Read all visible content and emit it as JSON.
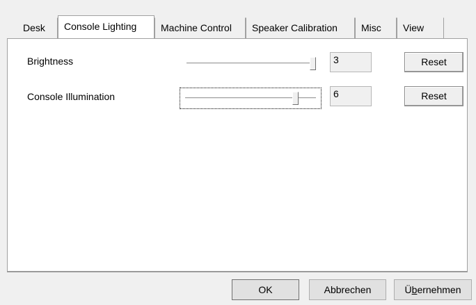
{
  "tabs": [
    {
      "label": "Desk"
    },
    {
      "label": "Console Lighting"
    },
    {
      "label": "Machine Control"
    },
    {
      "label": "Speaker Calibration"
    },
    {
      "label": "Misc"
    },
    {
      "label": "View"
    }
  ],
  "selected_tab": "Console Lighting",
  "settings": [
    {
      "label": "Brightness",
      "value": "3",
      "slider_level": 1.0,
      "reset_label": "Reset"
    },
    {
      "label": "Console Illumination",
      "value": "6",
      "slider_level": 0.85,
      "reset_label": "Reset"
    }
  ],
  "footer": {
    "ok_label": "OK",
    "cancel_label": "Abbrechen",
    "apply_label_first": "Ü",
    "apply_label_accel": "b",
    "apply_label_rest": "ernehmen"
  }
}
